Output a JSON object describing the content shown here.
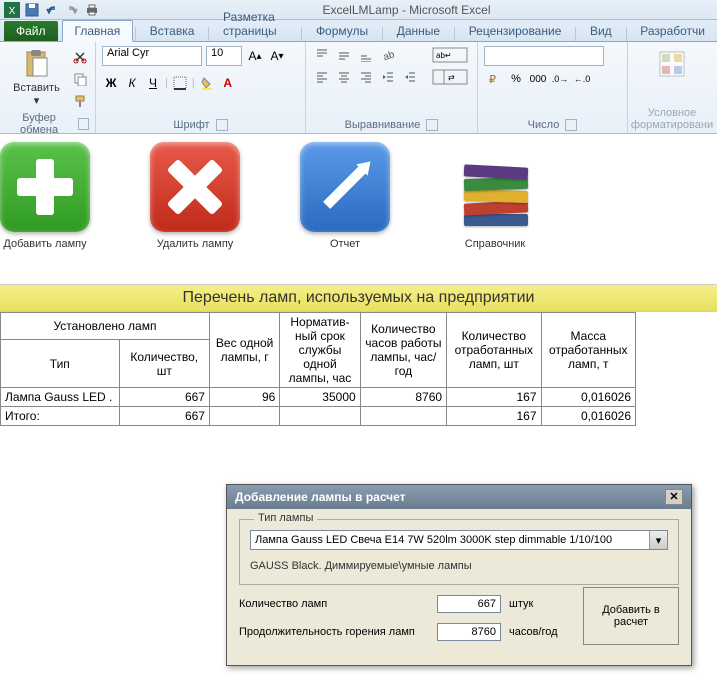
{
  "titlebar": {
    "text": "ExcelLMLamp - Microsoft Excel"
  },
  "tabs": {
    "file": "Файл",
    "items": [
      "Главная",
      "Вставка",
      "Разметка страницы",
      "Формулы",
      "Данные",
      "Рецензирование",
      "Вид",
      "Разработчи"
    ],
    "active": 0
  },
  "ribbon": {
    "clipboard": {
      "label": "Буфер обмена",
      "paste": "Вставить"
    },
    "font": {
      "label": "Шрифт",
      "name": "Arial Cyr",
      "size": "10"
    },
    "alignment": {
      "label": "Выравнивание"
    },
    "number": {
      "label": "Число"
    },
    "styles": {
      "label": "Условное",
      "label2": "форматировани"
    }
  },
  "custom": {
    "add": "Добавить лампу",
    "del": "Удалить лампу",
    "report": "Отчет",
    "ref": "Справочник"
  },
  "sheet_header": "Перечень ламп, используемых на предприятии",
  "table": {
    "hdr_installed": "Установлено ламп",
    "hdr_type": "Тип",
    "hdr_qty": "Количество, шт",
    "hdr_weight": "Вес одной лампы, г",
    "hdr_norm": "Норматив-ный срок службы одной лампы, час",
    "hdr_hours": "Количество часов работы лампы, час/год",
    "hdr_worked": "Количество отработанных ламп, шт",
    "hdr_mass": "Масса отработанных ламп, т",
    "rows": [
      {
        "type": "Лампа Gauss LED .",
        "qty": "667",
        "weight": "96",
        "norm": "35000",
        "hours": "8760",
        "worked": "167",
        "mass": "0,016026"
      },
      {
        "type": "Итого:",
        "qty": "667",
        "weight": "",
        "norm": "",
        "hours": "",
        "worked": "167",
        "mass": "0,016026"
      }
    ]
  },
  "dialog": {
    "title": "Добавление лампы в расчет",
    "group": "Тип лампы",
    "combo": "Лампа Gauss LED Свеча E14 7W 520lm 3000K step dimmable 1/10/100",
    "subtext": "GAUSS Black. Диммируемые\\умные лампы",
    "qty_label": "Количество ламп",
    "qty_value": "667",
    "qty_unit": "штук",
    "dur_label": "Продолжительность горения ламп",
    "dur_value": "8760",
    "dur_unit": "часов/год",
    "submit": "Добавить в расчет"
  }
}
